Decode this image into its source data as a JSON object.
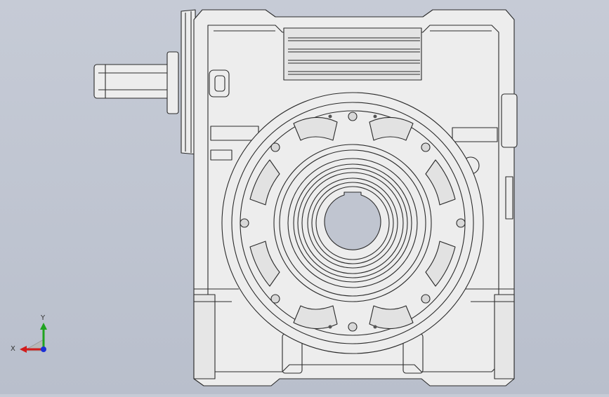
{
  "viewport": {
    "background_top": "#c6cbd6",
    "background_bottom": "#b9bfcc",
    "model_fill": "#ededed",
    "model_stroke": "#2a2a2a"
  },
  "triad": {
    "x_label": "X",
    "y_label": "Y",
    "x_color": "#d21b1b",
    "y_color": "#1fa31f",
    "z_color": "#1b2fd6"
  }
}
